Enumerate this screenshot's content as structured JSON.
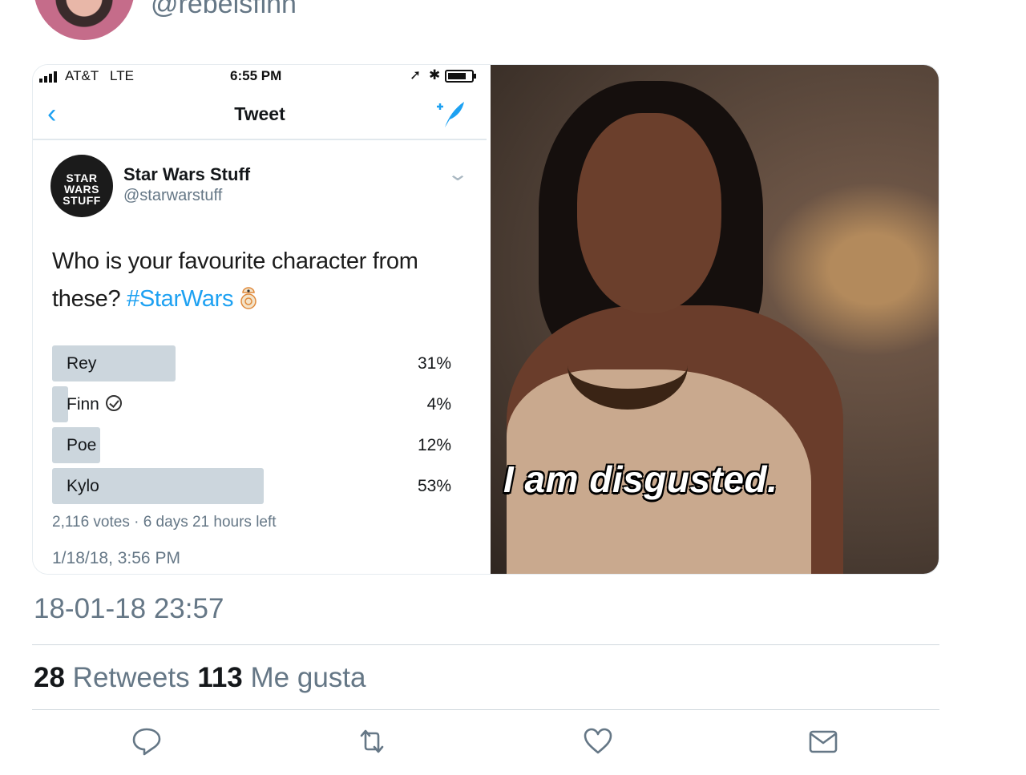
{
  "header": {
    "handle": "@rebelsfinn"
  },
  "phone_status": {
    "carrier": "AT&T",
    "network": "LTE",
    "time": "6:55 PM"
  },
  "nav": {
    "title": "Tweet"
  },
  "embedded_tweet": {
    "name": "Star Wars Stuff",
    "handle": "@starwarstuff",
    "avatar_text": [
      "STAR",
      "WARS",
      "STUFF"
    ],
    "text_main": "Who is your favourite character from these? ",
    "hashtag": "#StarWars",
    "poll": {
      "options": [
        {
          "label": "Rey",
          "percent": "31%",
          "value": 31,
          "selected": false
        },
        {
          "label": "Finn",
          "percent": "4%",
          "value": 4,
          "selected": true
        },
        {
          "label": "Poe",
          "percent": "12%",
          "value": 12,
          "selected": false
        },
        {
          "label": "Kylo",
          "percent": "53%",
          "value": 53,
          "selected": false
        }
      ],
      "meta": "2,116 votes · 6 days 21 hours left"
    },
    "date": "1/18/18, 3:56 PM"
  },
  "gif": {
    "caption": "I am disgusted."
  },
  "tweet": {
    "timestamp": "18-01-18 23:57",
    "retweets_count": "28",
    "retweets_label": "Retweets",
    "likes_count": "113",
    "likes_label": "Me gusta"
  },
  "icons": [
    "reply-icon",
    "retweet-icon",
    "like-icon",
    "dm-icon"
  ],
  "colors": {
    "accent": "#1da1f2",
    "secondary_text": "#657786",
    "poll_bar": "#ccd6dd"
  }
}
